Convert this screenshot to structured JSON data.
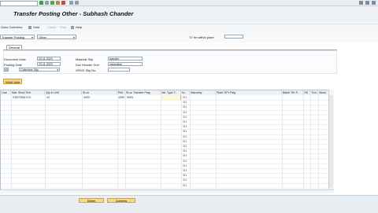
{
  "window": {
    "title": "Transfer Posting Other - Subhash Chander"
  },
  "toolbar": {
    "command_placeholder": ""
  },
  "appbar": {
    "items": [
      {
        "label": "Goes Overview",
        "enabled": true
      },
      {
        "label": "Hold",
        "enabled": true
      },
      {
        "label": "Check",
        "enabled": false
      },
      {
        "label": "Post",
        "enabled": false
      },
      {
        "label": "Help",
        "enabled": true
      }
    ]
  },
  "filters": {
    "transaction": "Transfer Posting",
    "reference": "Other",
    "plant_label": "'O' trn within plant"
  },
  "tabs": {
    "general": "General"
  },
  "form": {
    "document_date_label": "Document Date",
    "document_date": "23.11.2023",
    "posting_date_label": "Posting Date",
    "posting_date": "23.11.2023",
    "slip_mode": "Collective Slip",
    "material_slip_label": "Material Slip",
    "material_slip": "transfer",
    "doc_header_text_label": "Doc Header Text",
    "doc_header_text": "inspection",
    "gr_gi_slip_label": "GR/GI Slip No."
  },
  "initial_button": "Initial data",
  "grid": {
    "headers": [
      "Line",
      "Mat. Short Text",
      "Qty in UnE",
      "SLoc",
      "Plnt",
      "SLoc Transfer Pstg",
      "Val. Type T...",
      "M...",
      "Warranty",
      "Plant TrPr Pstg",
      "Batch Trfr P...",
      "OK",
      "TLin",
      "Stock"
    ],
    "rows": [
      {
        "line": "",
        "text": "CEDTDMCCO",
        "qty": "10",
        "sloc": "0003",
        "plnt": "1000",
        "sloc_trf": "0003",
        "val": "",
        "mv": "311"
      },
      {
        "line": "",
        "text": "",
        "qty": "",
        "sloc": "",
        "plnt": "",
        "sloc_trf": "",
        "val": "",
        "mv": "311"
      },
      {
        "line": "",
        "text": "",
        "qty": "",
        "sloc": "",
        "plnt": "",
        "sloc_trf": "",
        "val": "",
        "mv": "311"
      },
      {
        "line": "",
        "text": "",
        "qty": "",
        "sloc": "",
        "plnt": "",
        "sloc_trf": "",
        "val": "",
        "mv": "311"
      },
      {
        "line": "",
        "text": "",
        "qty": "",
        "sloc": "",
        "plnt": "",
        "sloc_trf": "",
        "val": "",
        "mv": "311"
      },
      {
        "line": "",
        "text": "",
        "qty": "",
        "sloc": "",
        "plnt": "",
        "sloc_trf": "",
        "val": "",
        "mv": "311"
      },
      {
        "line": "",
        "text": "",
        "qty": "",
        "sloc": "",
        "plnt": "",
        "sloc_trf": "",
        "val": "",
        "mv": "311"
      },
      {
        "line": "",
        "text": "",
        "qty": "",
        "sloc": "",
        "plnt": "",
        "sloc_trf": "",
        "val": "",
        "mv": "311"
      },
      {
        "line": "",
        "text": "",
        "qty": "",
        "sloc": "",
        "plnt": "",
        "sloc_trf": "",
        "val": "",
        "mv": "311"
      },
      {
        "line": "",
        "text": "",
        "qty": "",
        "sloc": "",
        "plnt": "",
        "sloc_trf": "",
        "val": "",
        "mv": "311"
      },
      {
        "line": "",
        "text": "",
        "qty": "",
        "sloc": "",
        "plnt": "",
        "sloc_trf": "",
        "val": "",
        "mv": "311"
      },
      {
        "line": "",
        "text": "",
        "qty": "",
        "sloc": "",
        "plnt": "",
        "sloc_trf": "",
        "val": "",
        "mv": "311"
      },
      {
        "line": "",
        "text": "",
        "qty": "",
        "sloc": "",
        "plnt": "",
        "sloc_trf": "",
        "val": "",
        "mv": "311"
      },
      {
        "line": "",
        "text": "",
        "qty": "",
        "sloc": "",
        "plnt": "",
        "sloc_trf": "",
        "val": "",
        "mv": "311"
      },
      {
        "line": "",
        "text": "",
        "qty": "",
        "sloc": "",
        "plnt": "",
        "sloc_trf": "",
        "val": "",
        "mv": "311"
      },
      {
        "line": "",
        "text": "",
        "qty": "",
        "sloc": "",
        "plnt": "",
        "sloc_trf": "",
        "val": "",
        "mv": "311"
      },
      {
        "line": "",
        "text": "",
        "qty": "",
        "sloc": "",
        "plnt": "",
        "sloc_trf": "",
        "val": "",
        "mv": "311"
      },
      {
        "line": "",
        "text": "",
        "qty": "",
        "sloc": "",
        "plnt": "",
        "sloc_trf": "",
        "val": "",
        "mv": "311"
      },
      {
        "line": "",
        "text": "",
        "qty": "",
        "sloc": "",
        "plnt": "",
        "sloc_trf": "",
        "val": "",
        "mv": "311"
      }
    ]
  },
  "footer": {
    "buttons": [
      "Delete",
      "Contents"
    ]
  },
  "colors": {
    "toolbar_bg": "#e9eef3",
    "accent_button": "#f1d58b"
  }
}
